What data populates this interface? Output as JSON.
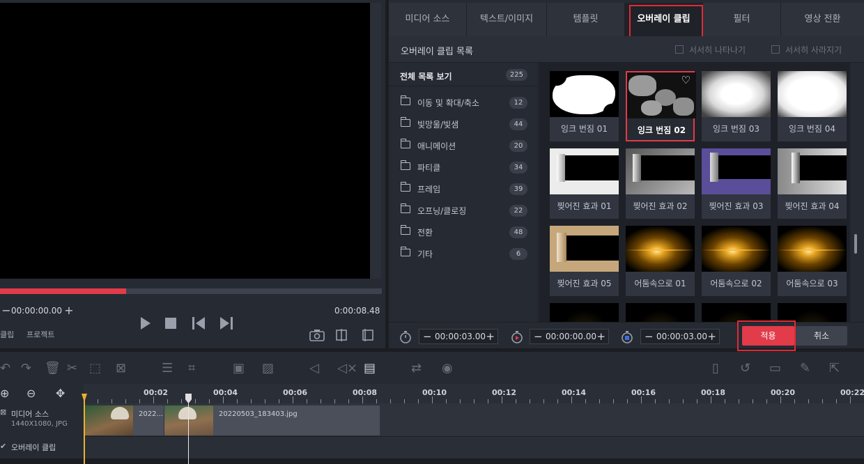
{
  "preview": {
    "timecode": "00:00:00.00",
    "duration": "0:00:08.48",
    "progress_percent": 33,
    "bottom_labels": [
      "클립",
      "프로젝트"
    ]
  },
  "tabs": [
    "미디어 소스",
    "텍스트/이미지",
    "템플릿",
    "오버레이 클립",
    "필터",
    "영상 전환"
  ],
  "active_tab": 3,
  "panel": {
    "title": "오버레이 클립 목록",
    "fade_in": "서서히 나타나기",
    "fade_out": "서서히 사라지기"
  },
  "categories": [
    {
      "label": "전체 목록 보기",
      "count": "225"
    },
    {
      "label": "이동 및 확대/축소",
      "count": "12"
    },
    {
      "label": "빛망울/빛샘",
      "count": "44"
    },
    {
      "label": "애니메이션",
      "count": "20"
    },
    {
      "label": "파티클",
      "count": "34"
    },
    {
      "label": "프레임",
      "count": "39"
    },
    {
      "label": "오프닝/클로징",
      "count": "22"
    },
    {
      "label": "전환",
      "count": "48"
    },
    {
      "label": "기타",
      "count": "6"
    }
  ],
  "clips": [
    {
      "label": "잉크 번짐 01",
      "kind": "ink"
    },
    {
      "label": "잉크 번짐 02",
      "kind": "ink2"
    },
    {
      "label": "잉크 번짐 03",
      "kind": "ink3"
    },
    {
      "label": "잉크 번짐 04",
      "kind": "ink4"
    },
    {
      "label": "찢어진 효과 01",
      "kind": "tear1"
    },
    {
      "label": "찢어진 효과 02",
      "kind": "tear2"
    },
    {
      "label": "찢어진 효과 03",
      "kind": "tear3"
    },
    {
      "label": "찢어진 효과 04",
      "kind": "tear4"
    },
    {
      "label": "찢어진 효과 05",
      "kind": "tear5"
    },
    {
      "label": "어둠속으로 01",
      "kind": "spark"
    },
    {
      "label": "어둠속으로 02",
      "kind": "spark"
    },
    {
      "label": "어둠속으로 03",
      "kind": "spark"
    },
    {
      "label": "",
      "kind": "dark"
    },
    {
      "label": "",
      "kind": "dark"
    },
    {
      "label": "",
      "kind": "dark"
    },
    {
      "label": "",
      "kind": "dark"
    }
  ],
  "selected_clip": 1,
  "bottom": {
    "duration": "00:00:03.00",
    "start": "00:00:00.00",
    "fade": "00:00:03.00",
    "apply": "적용",
    "cancel": "취소"
  },
  "timeline": {
    "ruler": [
      "00:02",
      "00:04",
      "00:06",
      "00:08",
      "00:10",
      "00:12",
      "00:14",
      "00:16",
      "00:18",
      "00:20",
      "00:22"
    ],
    "tracks": [
      {
        "name": "미디어 소스",
        "info": "1440X1080, JPG"
      },
      {
        "name": "오버레이 클립",
        "info": ""
      }
    ],
    "clip1_label": "2022...",
    "clip2_label": "20220503_183403.jpg"
  },
  "colors": {
    "accent": "#e23b4a",
    "highlight": "#e22a36"
  }
}
